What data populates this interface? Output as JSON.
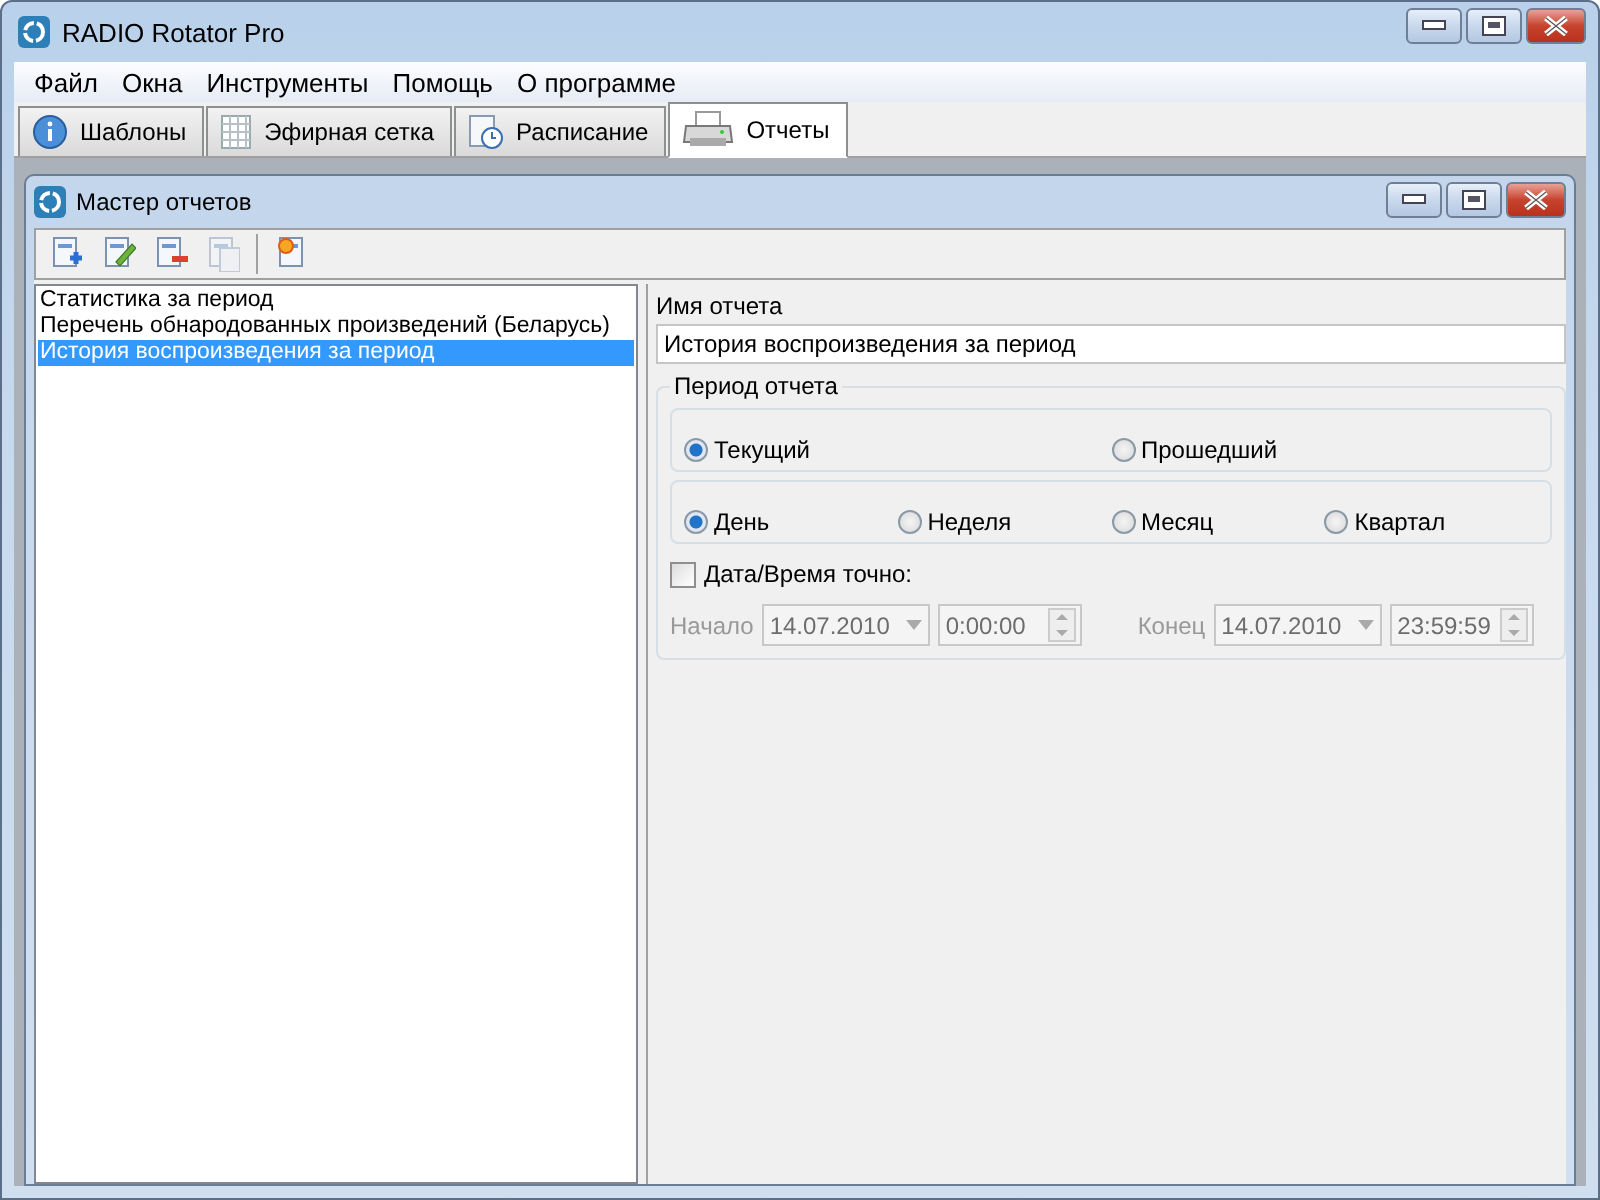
{
  "window": {
    "title": "RADIO Rotator Pro"
  },
  "menu": [
    "Файл",
    "Окна",
    "Инструменты",
    "Помощь",
    "О программе"
  ],
  "tabs": [
    {
      "label": "Шаблоны",
      "selected": false
    },
    {
      "label": "Эфирная сетка",
      "selected": false
    },
    {
      "label": "Расписание",
      "selected": false
    },
    {
      "label": "Отчеты",
      "selected": true
    }
  ],
  "child_window": {
    "title": "Мастер отчетов"
  },
  "toolbar": [
    {
      "disabled": false
    },
    {
      "disabled": false
    },
    {
      "disabled": false
    },
    {
      "disabled": true
    },
    {
      "disabled": false
    }
  ],
  "reports": [
    {
      "label": "Статистика за период",
      "selected": false
    },
    {
      "label": "Перечень обнародованных произведений (Беларусь)",
      "selected": false
    },
    {
      "label": "История воспроизведения за период",
      "selected": true
    }
  ],
  "name_field": {
    "label": "Имя отчета",
    "value": "История воспроизведения за период"
  },
  "period": {
    "title": "Период отчета",
    "range": [
      {
        "label": "Текущий",
        "selected": true
      },
      {
        "label": "Прошедший",
        "selected": false
      }
    ],
    "unit": [
      {
        "label": "День",
        "selected": true
      },
      {
        "label": "Неделя",
        "selected": false
      },
      {
        "label": "Месяц",
        "selected": false
      },
      {
        "label": "Квартал",
        "selected": false
      }
    ],
    "exact": {
      "label": "Дата/Время точно:",
      "checked": false
    },
    "start": {
      "label": "Начало",
      "date": "14.07.2010",
      "time": "0:00:00",
      "disabled": true
    },
    "end": {
      "label": "Конец",
      "date": "14.07.2010",
      "time": "23:59:59",
      "disabled": true
    }
  }
}
